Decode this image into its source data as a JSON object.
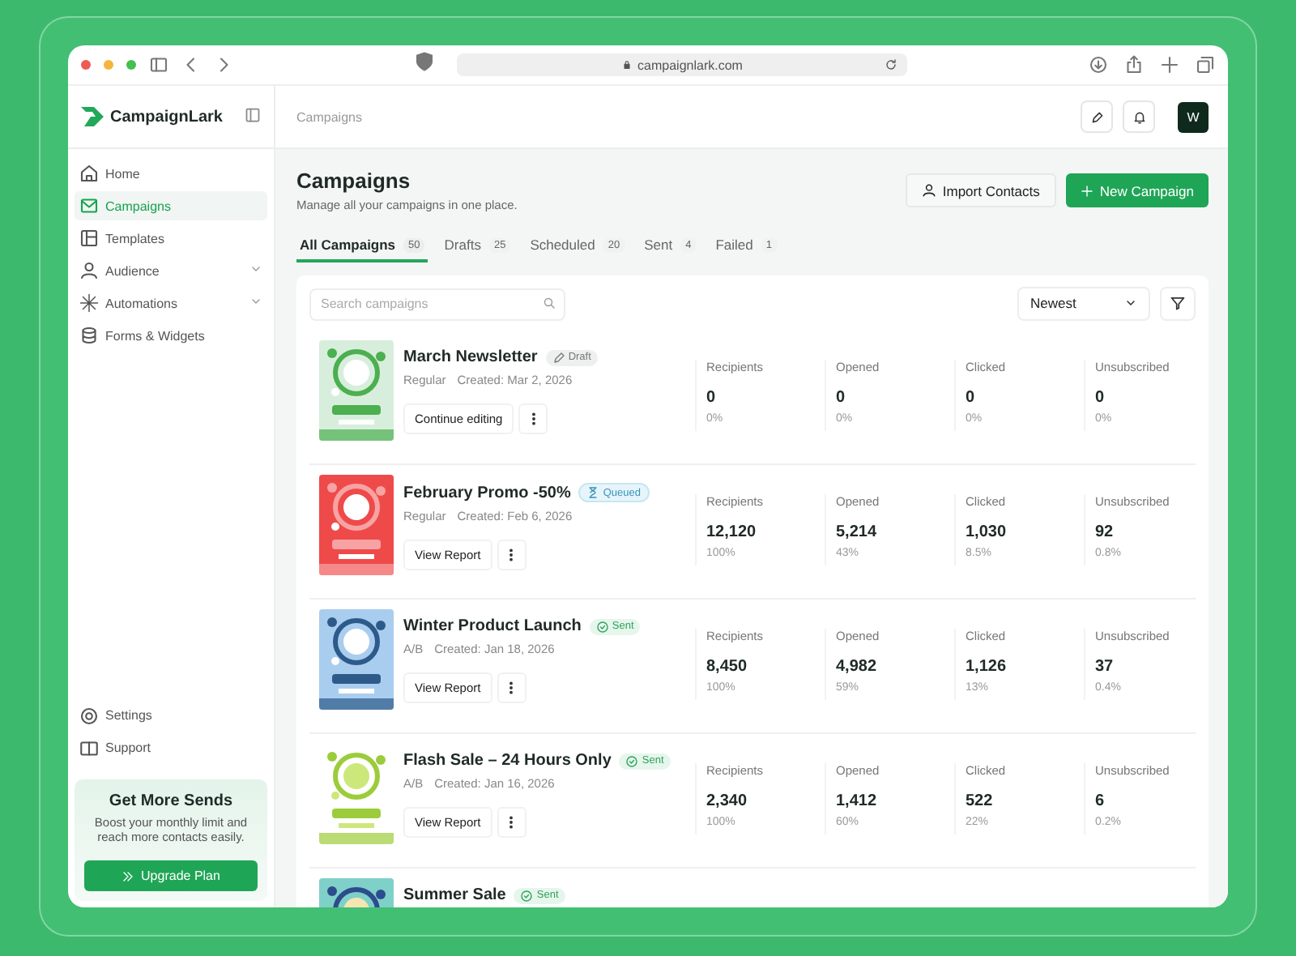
{
  "browser": {
    "url": "campaignlark.com"
  },
  "sidebar": {
    "brand": "CampaignLark",
    "items": [
      {
        "label": "Home",
        "selected": false,
        "expandable": false
      },
      {
        "label": "Campaigns",
        "selected": true,
        "expandable": false
      },
      {
        "label": "Templates",
        "selected": false,
        "expandable": false
      },
      {
        "label": "Audience",
        "selected": false,
        "expandable": true
      },
      {
        "label": "Automations",
        "selected": false,
        "expandable": true
      },
      {
        "label": "Forms & Widgets",
        "selected": false,
        "expandable": false
      }
    ],
    "footer_items": [
      {
        "label": "Settings"
      },
      {
        "label": "Support"
      }
    ],
    "promo": {
      "title": "Get More Sends",
      "text": "Boost your monthly limit and reach more contacts easily.",
      "button": "Upgrade Plan"
    }
  },
  "header": {
    "breadcrumb": "Campaigns",
    "avatar": "W"
  },
  "page": {
    "title": "Campaigns",
    "subtitle": "Manage all your campaigns in one place.",
    "buttons": [
      {
        "label": "Import Contacts",
        "kind": "secondary"
      },
      {
        "label": "New Campaign",
        "kind": "primary"
      }
    ]
  },
  "tabs": [
    {
      "label": "All Campaigns",
      "count": "50",
      "selected": true
    },
    {
      "label": "Drafts",
      "count": "25",
      "selected": false
    },
    {
      "label": "Scheduled",
      "count": "20",
      "selected": false
    },
    {
      "label": "Sent",
      "count": "4",
      "selected": false
    },
    {
      "label": "Failed",
      "count": "1",
      "selected": false
    }
  ],
  "search": {
    "placeholder": "Search campaigns"
  },
  "sort": {
    "value": "Newest"
  },
  "campaigns": [
    {
      "name": "March Newsletter",
      "status": "Draft",
      "kind": "draft",
      "type": "Regular",
      "created": "Created: Mar 2, 2026",
      "action": "Continue editing",
      "stats": [
        {
          "label": "Recipients",
          "value": "0",
          "percent": "0%"
        },
        {
          "label": "Opened",
          "value": "0",
          "percent": "0%"
        },
        {
          "label": "Clicked",
          "value": "0",
          "percent": "0%"
        },
        {
          "label": "Unsubscribed",
          "value": "0",
          "percent": "0%"
        }
      ]
    },
    {
      "name": "February Promo -50%",
      "status": "Queued",
      "kind": "queued",
      "type": "Regular",
      "created": "Created: Feb 6, 2026",
      "action": "View Report",
      "stats": [
        {
          "label": "Recipients",
          "value": "12,120",
          "percent": "100%"
        },
        {
          "label": "Opened",
          "value": "5,214",
          "percent": "43%"
        },
        {
          "label": "Clicked",
          "value": "1,030",
          "percent": "8.5%"
        },
        {
          "label": "Unsubscribed",
          "value": "92",
          "percent": "0.8%"
        }
      ]
    },
    {
      "name": "Winter Product Launch",
      "status": "Sent",
      "kind": "sent",
      "type": "A/B",
      "created": "Created: Jan 18, 2026",
      "action": "View Report",
      "stats": [
        {
          "label": "Recipients",
          "value": "8,450",
          "percent": "100%"
        },
        {
          "label": "Opened",
          "value": "4,982",
          "percent": "59%"
        },
        {
          "label": "Clicked",
          "value": "1,126",
          "percent": "13%"
        },
        {
          "label": "Unsubscribed",
          "value": "37",
          "percent": "0.4%"
        }
      ]
    },
    {
      "name": "Flash Sale – 24 Hours Only",
      "status": "Sent",
      "kind": "sent",
      "type": "A/B",
      "created": "Created: Jan 16, 2026",
      "action": "View Report",
      "stats": [
        {
          "label": "Recipients",
          "value": "2,340",
          "percent": "100%"
        },
        {
          "label": "Opened",
          "value": "1,412",
          "percent": "60%"
        },
        {
          "label": "Clicked",
          "value": "522",
          "percent": "22%"
        },
        {
          "label": "Unsubscribed",
          "value": "6",
          "percent": "0.2%"
        }
      ]
    },
    {
      "name": "Summer Sale",
      "status": "Sent",
      "kind": "sent"
    }
  ]
}
